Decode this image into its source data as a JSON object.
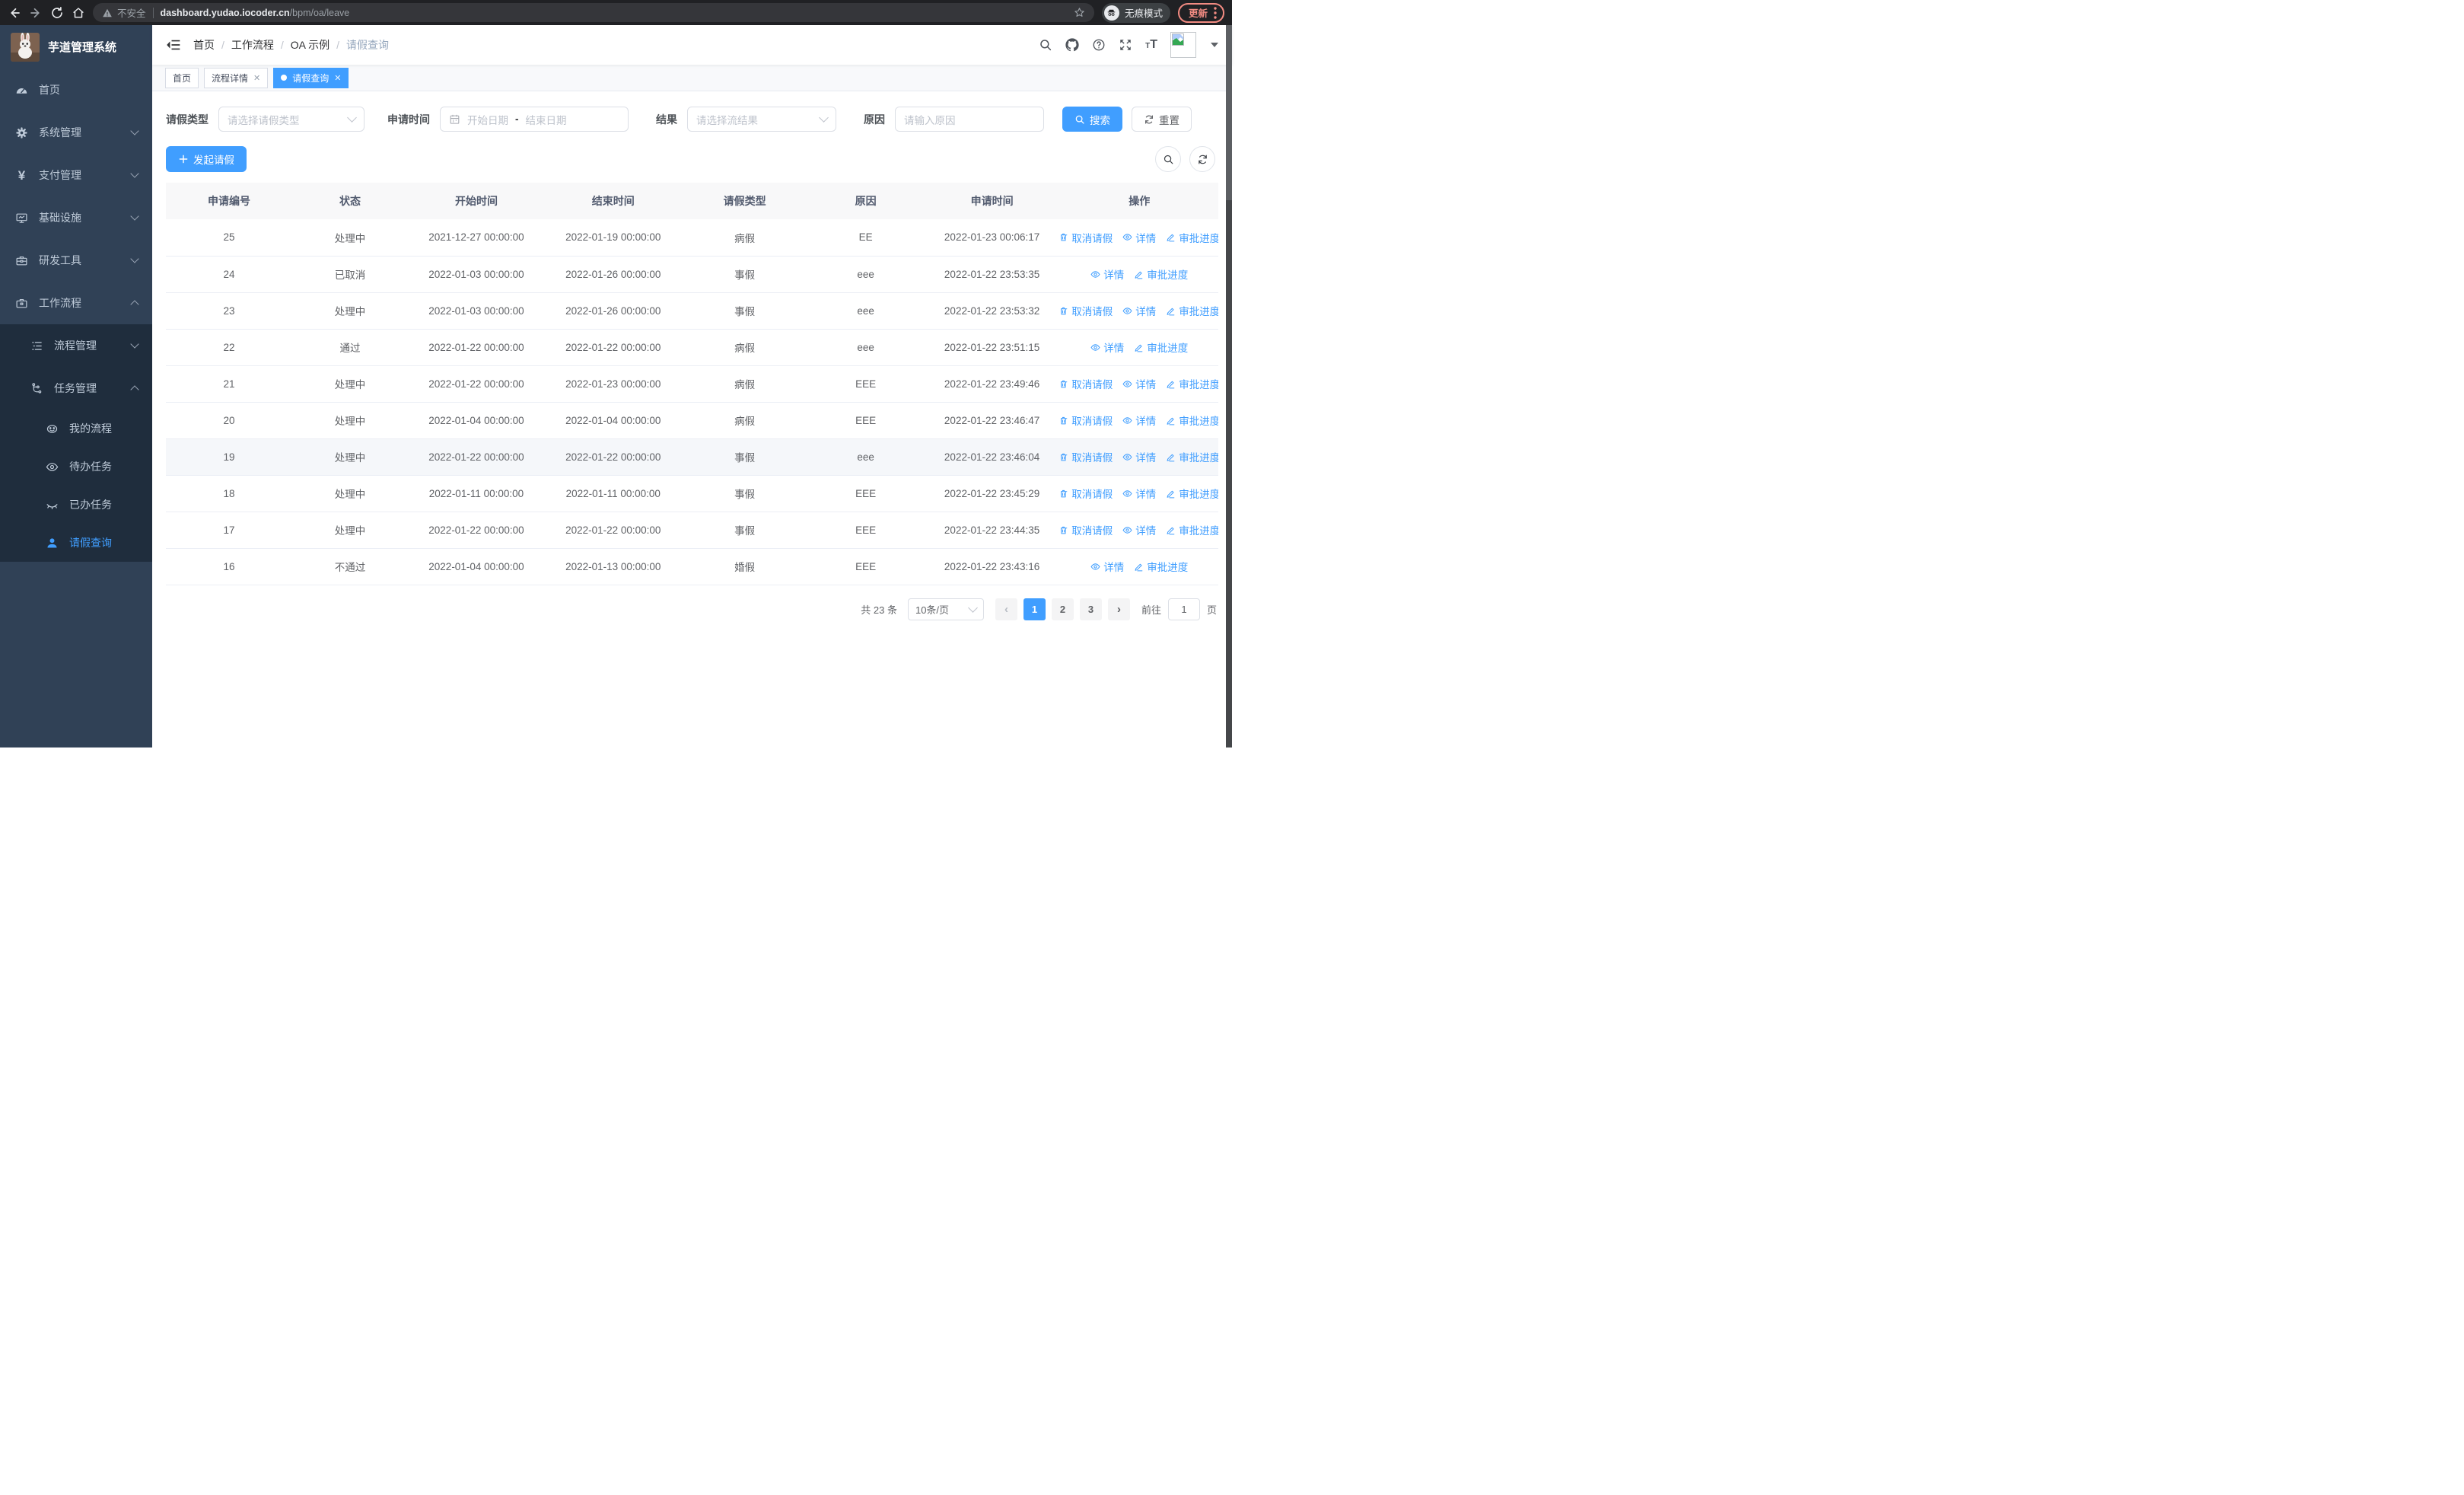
{
  "colors": {
    "accent": "#409eff",
    "sidebar_bg": "#304156",
    "submenu_bg": "#1f2d3d",
    "chrome_bg": "#202124",
    "update_red": "#f28b82"
  },
  "browser": {
    "security_label": "不安全",
    "url_host": "dashboard.yudao.iocoder.cn",
    "url_path": "/bpm/oa/leave",
    "incognito_label": "无痕模式",
    "update_label": "更新"
  },
  "sidebar": {
    "title": "芋道管理系统",
    "menu": [
      {
        "label": "首页",
        "icon": "dashboard-icon"
      },
      {
        "label": "系统管理",
        "icon": "gear-icon"
      },
      {
        "label": "支付管理",
        "icon": "yen-icon"
      },
      {
        "label": "基础设施",
        "icon": "monitor-icon"
      },
      {
        "label": "研发工具",
        "icon": "toolbox-icon"
      },
      {
        "label": "工作流程",
        "icon": "briefcase-icon"
      },
      {
        "label": "流程管理",
        "icon": "tree-list-icon"
      },
      {
        "label": "任务管理",
        "icon": "flow-icon"
      },
      {
        "label": "我的流程",
        "icon": "robot-face-icon"
      },
      {
        "label": "待办任务",
        "icon": "eye-icon"
      },
      {
        "label": "已办任务",
        "icon": "eye-closed-icon"
      },
      {
        "label": "请假查询",
        "icon": "user-icon"
      }
    ]
  },
  "navbar": {
    "breadcrumb": [
      "首页",
      "工作流程",
      "OA 示例",
      "请假查询"
    ],
    "font_size_icon": "tT"
  },
  "tabs": [
    {
      "label": "首页",
      "closable": false,
      "active": false
    },
    {
      "label": "流程详情",
      "closable": true,
      "active": false
    },
    {
      "label": "请假查询",
      "closable": true,
      "active": true
    }
  ],
  "filters": {
    "type_label": "请假类型",
    "type_placeholder": "请选择请假类型",
    "time_label": "申请时间",
    "start_placeholder": "开始日期",
    "range_separator": "-",
    "end_placeholder": "结束日期",
    "result_label": "结果",
    "result_placeholder": "请选择流结果",
    "reason_label": "原因",
    "reason_placeholder": "请输入原因",
    "search_label": "搜索",
    "reset_label": "重置"
  },
  "toolbar": {
    "create_label": "发起请假"
  },
  "table": {
    "columns": [
      "申请编号",
      "状态",
      "开始时间",
      "结束时间",
      "请假类型",
      "原因",
      "申请时间",
      "操作"
    ],
    "action_defs": {
      "cancel": {
        "label": "取消请假",
        "icon": "trash-icon"
      },
      "detail": {
        "label": "详情",
        "icon": "view-icon"
      },
      "progress": {
        "label": "审批进度",
        "icon": "edit-icon"
      }
    },
    "rows": [
      {
        "id": "25",
        "status": "处理中",
        "start": "2021-12-27 00:00:00",
        "end": "2022-01-19 00:00:00",
        "type": "病假",
        "reason": "EE",
        "apply": "2022-01-23 00:06:17",
        "actions": [
          "cancel",
          "detail",
          "progress"
        ],
        "highlighted": false
      },
      {
        "id": "24",
        "status": "已取消",
        "start": "2022-01-03 00:00:00",
        "end": "2022-01-26 00:00:00",
        "type": "事假",
        "reason": "eee",
        "apply": "2022-01-22 23:53:35",
        "actions": [
          "detail",
          "progress"
        ],
        "highlighted": false
      },
      {
        "id": "23",
        "status": "处理中",
        "start": "2022-01-03 00:00:00",
        "end": "2022-01-26 00:00:00",
        "type": "事假",
        "reason": "eee",
        "apply": "2022-01-22 23:53:32",
        "actions": [
          "cancel",
          "detail",
          "progress"
        ],
        "highlighted": false
      },
      {
        "id": "22",
        "status": "通过",
        "start": "2022-01-22 00:00:00",
        "end": "2022-01-22 00:00:00",
        "type": "病假",
        "reason": "eee",
        "apply": "2022-01-22 23:51:15",
        "actions": [
          "detail",
          "progress"
        ],
        "highlighted": false
      },
      {
        "id": "21",
        "status": "处理中",
        "start": "2022-01-22 00:00:00",
        "end": "2022-01-23 00:00:00",
        "type": "病假",
        "reason": "EEE",
        "apply": "2022-01-22 23:49:46",
        "actions": [
          "cancel",
          "detail",
          "progress"
        ],
        "highlighted": false
      },
      {
        "id": "20",
        "status": "处理中",
        "start": "2022-01-04 00:00:00",
        "end": "2022-01-04 00:00:00",
        "type": "病假",
        "reason": "EEE",
        "apply": "2022-01-22 23:46:47",
        "actions": [
          "cancel",
          "detail",
          "progress"
        ],
        "highlighted": false
      },
      {
        "id": "19",
        "status": "处理中",
        "start": "2022-01-22 00:00:00",
        "end": "2022-01-22 00:00:00",
        "type": "事假",
        "reason": "eee",
        "apply": "2022-01-22 23:46:04",
        "actions": [
          "cancel",
          "detail",
          "progress"
        ],
        "highlighted": true
      },
      {
        "id": "18",
        "status": "处理中",
        "start": "2022-01-11 00:00:00",
        "end": "2022-01-11 00:00:00",
        "type": "事假",
        "reason": "EEE",
        "apply": "2022-01-22 23:45:29",
        "actions": [
          "cancel",
          "detail",
          "progress"
        ],
        "highlighted": false
      },
      {
        "id": "17",
        "status": "处理中",
        "start": "2022-01-22 00:00:00",
        "end": "2022-01-22 00:00:00",
        "type": "事假",
        "reason": "EEE",
        "apply": "2022-01-22 23:44:35",
        "actions": [
          "cancel",
          "detail",
          "progress"
        ],
        "highlighted": false
      },
      {
        "id": "16",
        "status": "不通过",
        "start": "2022-01-04 00:00:00",
        "end": "2022-01-13 00:00:00",
        "type": "婚假",
        "reason": "EEE",
        "apply": "2022-01-22 23:43:16",
        "actions": [
          "detail",
          "progress"
        ],
        "highlighted": false
      }
    ]
  },
  "pagination": {
    "total_label": "共 23 条",
    "page_size_label": "10条/页",
    "prev": "‹",
    "next": "›",
    "pages": [
      "1",
      "2",
      "3"
    ],
    "active_page": "1",
    "goto_label": "前往",
    "goto_value": "1",
    "unit_label": "页"
  }
}
